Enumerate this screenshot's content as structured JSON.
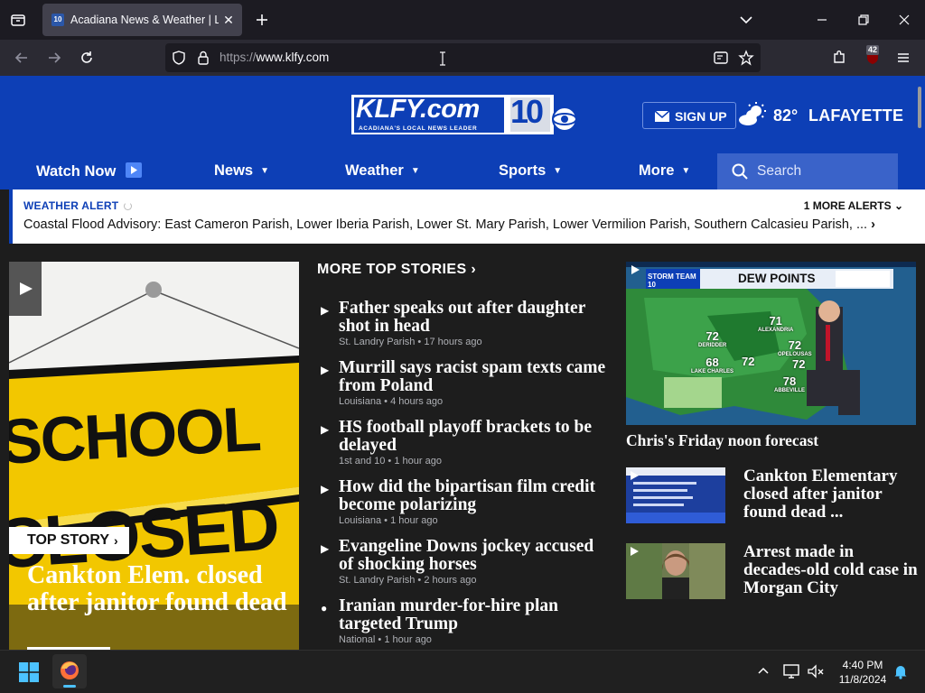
{
  "browser": {
    "tab_title": "Acadiana News & Weather | Lafayette",
    "tab_favicon_text": "10",
    "url_protocol": "https://",
    "url_host": "www.klfy.com",
    "extension_badge": "42"
  },
  "header": {
    "logo_text": "KLFY.com",
    "logo_channel": "10",
    "logo_tagline": "ACADIANA'S LOCAL NEWS LEADER",
    "signup_label": "SIGN UP",
    "temperature": "82°",
    "city": "LAFAYETTE"
  },
  "nav": {
    "watch_now": "Watch Now",
    "news": "News",
    "weather": "Weather",
    "sports": "Sports",
    "more": "More",
    "search_placeholder": "Search"
  },
  "alert": {
    "kind": "WEATHER ALERT",
    "more_alerts": "1 MORE ALERTS",
    "message": "Coastal Flood Advisory: East Cameron Parish, Lower Iberia Parish, Lower St. Mary Parish, Lower Vermilion Parish, Southern Calcasieu Parish, ..."
  },
  "top_story": {
    "badge": "TOP STORY",
    "headline": "Cankton Elem. closed after janitor found dead",
    "image_sign_word1": "SCHOOL",
    "image_sign_word2": "CLOSED"
  },
  "more_top_stories": {
    "heading": "MORE TOP STORIES",
    "items": [
      {
        "title": "Father speaks out after daughter shot in head",
        "source": "St. Landry Parish",
        "age": "17 hours ago",
        "kind": "video"
      },
      {
        "title": "Murrill says racist spam texts came from Poland",
        "source": "Louisiana",
        "age": "4 hours ago",
        "kind": "video"
      },
      {
        "title": "HS football playoff brackets to be delayed",
        "source": "1st and 10",
        "age": "1 hour ago",
        "kind": "video"
      },
      {
        "title": "How did the bipartisan film credit become polarizing",
        "source": "Louisiana",
        "age": "1 hour ago",
        "kind": "video"
      },
      {
        "title": "Evangeline Downs jockey accused of shocking horses",
        "source": "St. Landry Parish",
        "age": "2 hours ago",
        "kind": "video"
      },
      {
        "title": "Iranian murder-for-hire plan targeted Trump",
        "source": "National",
        "age": "1 hour ago",
        "kind": "article"
      }
    ]
  },
  "featured": {
    "caption": "Chris's Friday noon forecast",
    "map_title": "DEW POINTS",
    "map_brand": "STORM TEAM 10",
    "map_values": [
      {
        "label": "ALEXANDRIA",
        "value": "71"
      },
      {
        "label": "DERIDDER",
        "value": "72"
      },
      {
        "label": "OPELOUSAS",
        "value": "72"
      },
      {
        "label": "LAKE CHARLES",
        "value": "68"
      },
      {
        "label": "",
        "value": "72"
      },
      {
        "label": "",
        "value": "72"
      },
      {
        "label": "ABBEVILLE",
        "value": "78"
      }
    ]
  },
  "side_stories": [
    {
      "title": "Cankton Elementary closed after janitor found dead ..."
    },
    {
      "title": "Arrest made in decades-old cold case in Morgan City"
    }
  ],
  "taskbar": {
    "time": "4:40 PM",
    "date": "11/8/2024"
  },
  "colors": {
    "brand_blue": "#0d3fb6",
    "page_bg": "#1d1d1d",
    "search_bg": "#3a63c9"
  }
}
